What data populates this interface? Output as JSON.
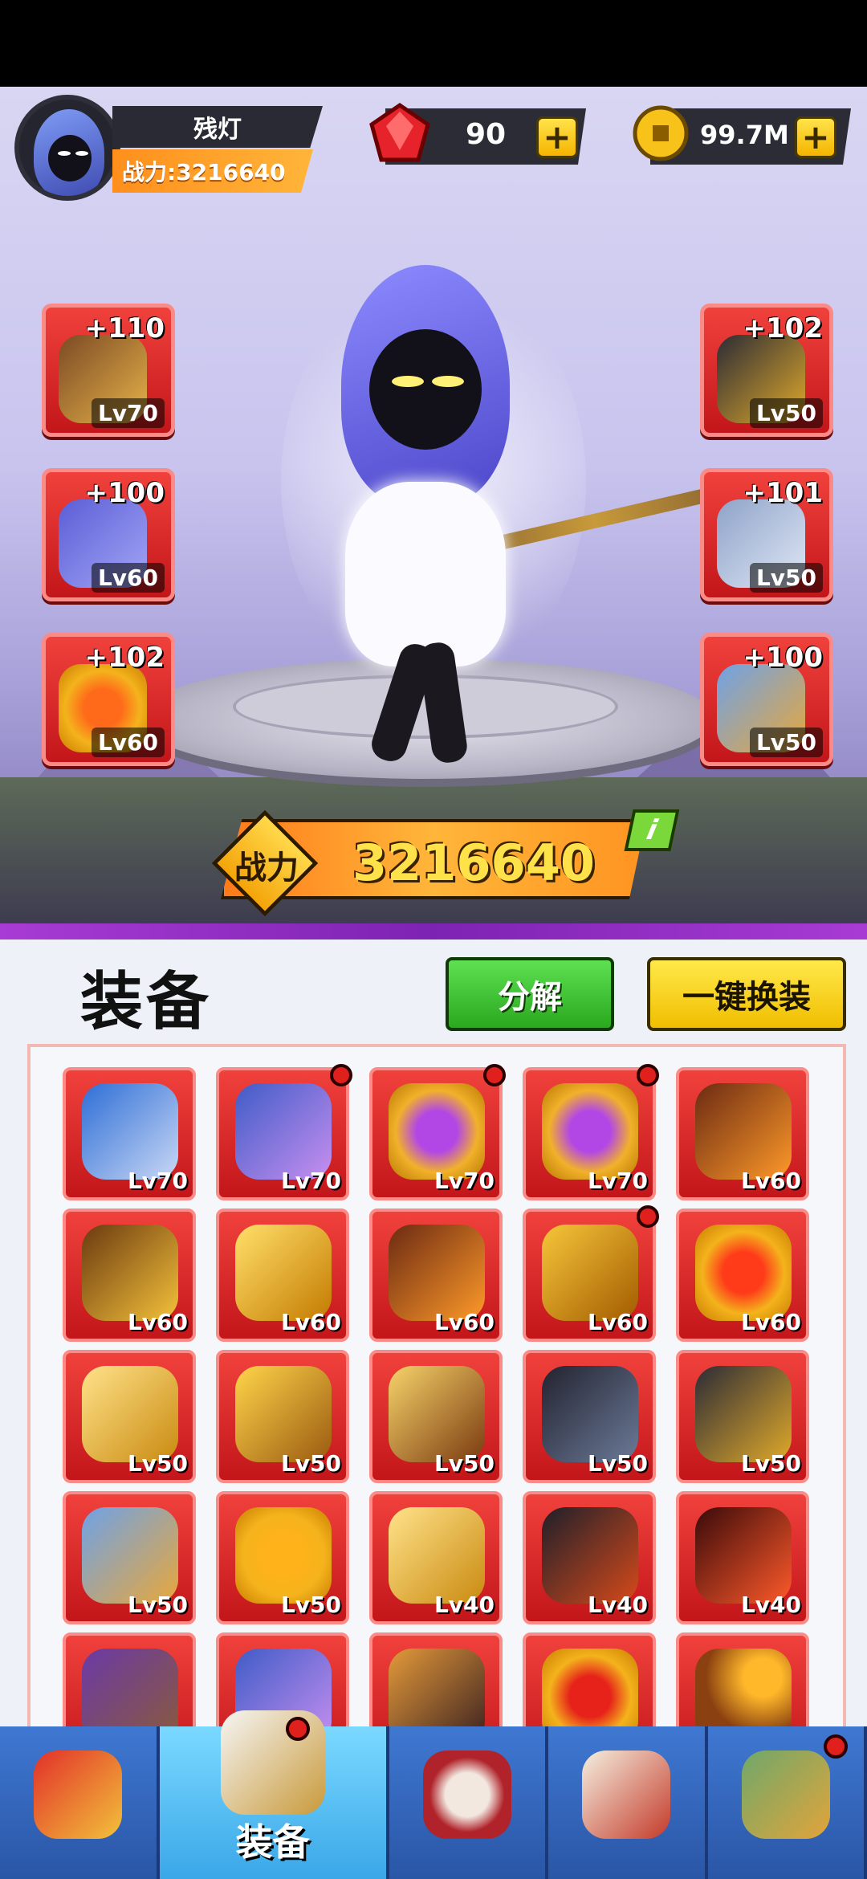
{
  "player": {
    "name": "残灯",
    "power_label": "战力:3216640"
  },
  "resources": {
    "gems": "90",
    "coins": "99.7M",
    "plus": "+"
  },
  "equipped_left": [
    {
      "bonus": "+110",
      "level": "Lv70",
      "icon": "claw-weapon-icon"
    },
    {
      "bonus": "+100",
      "level": "Lv60",
      "icon": "boots-icon"
    },
    {
      "bonus": "+102",
      "level": "Lv60",
      "icon": "ring-icon"
    }
  ],
  "equipped_right": [
    {
      "bonus": "+102",
      "level": "Lv50",
      "icon": "helmet-icon"
    },
    {
      "bonus": "+101",
      "level": "Lv50",
      "icon": "armor-icon"
    },
    {
      "bonus": "+100",
      "level": "Lv50",
      "icon": "bracer-icon"
    }
  ],
  "power_banner": {
    "label": "战力",
    "value": "3216640",
    "info": "i"
  },
  "panel": {
    "title": "装备",
    "decompose": "分解",
    "equip_all": "一键换装"
  },
  "inventory": [
    {
      "level": "Lv70",
      "icon": "spear-icon",
      "new": false
    },
    {
      "level": "Lv70",
      "icon": "hood-icon",
      "new": true
    },
    {
      "level": "Lv70",
      "icon": "amethyst-ring-icon",
      "new": true
    },
    {
      "level": "Lv70",
      "icon": "amethyst-ring-icon",
      "new": true
    },
    {
      "level": "Lv60",
      "icon": "flame-helmet-icon",
      "new": false
    },
    {
      "level": "Lv60",
      "icon": "golden-staff-icon",
      "new": false
    },
    {
      "level": "Lv60",
      "icon": "golden-blade-icon",
      "new": false
    },
    {
      "level": "Lv60",
      "icon": "flame-helmet-icon",
      "new": false
    },
    {
      "level": "Lv60",
      "icon": "golden-hat-icon",
      "new": true
    },
    {
      "level": "Lv60",
      "icon": "ruby-ring-icon",
      "new": false
    },
    {
      "level": "Lv50",
      "icon": "golden-sword-icon",
      "new": false
    },
    {
      "level": "Lv50",
      "icon": "golden-axe-icon",
      "new": false
    },
    {
      "level": "Lv50",
      "icon": "ornate-dagger-icon",
      "new": false
    },
    {
      "level": "Lv50",
      "icon": "dark-blade-icon",
      "new": false
    },
    {
      "level": "Lv50",
      "icon": "helmet-icon",
      "new": false
    },
    {
      "level": "Lv50",
      "icon": "bracer-icon",
      "new": false
    },
    {
      "level": "Lv50",
      "icon": "amber-ring-icon",
      "new": false
    },
    {
      "level": "Lv40",
      "icon": "golden-sword-icon",
      "new": false
    },
    {
      "level": "Lv40",
      "icon": "dagger-icon",
      "new": false
    },
    {
      "level": "Lv40",
      "icon": "red-helmet-icon",
      "new": false
    },
    {
      "level": "",
      "icon": "boots-icon",
      "new": false
    },
    {
      "level": "",
      "icon": "hood-icon",
      "new": false
    },
    {
      "level": "",
      "icon": "gauntlet-icon",
      "new": false
    },
    {
      "level": "",
      "icon": "fire-ring-icon",
      "new": false
    },
    {
      "level": "",
      "icon": "orb-staff-icon",
      "new": false
    }
  ],
  "nav": [
    {
      "label": "",
      "icon": "hero-icon",
      "active": false,
      "dot": false
    },
    {
      "label": "装备",
      "icon": "sword-icon",
      "active": true,
      "dot": true
    },
    {
      "label": "",
      "icon": "drum-icon",
      "active": false,
      "dot": false
    },
    {
      "label": "",
      "icon": "scroll-icon",
      "active": false,
      "dot": false
    },
    {
      "label": "",
      "icon": "castle-icon",
      "active": false,
      "dot": true
    }
  ],
  "colors": {
    "slot_red": "#d92520",
    "accent_orange": "#ff9a22",
    "accent_yellow": "#ffe24a",
    "green_button": "#3cc22e",
    "nav_blue": "#2a56a6"
  }
}
